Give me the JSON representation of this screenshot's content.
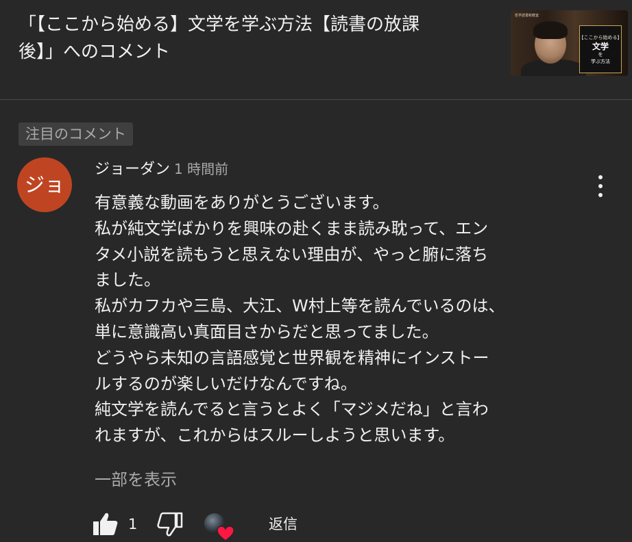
{
  "header": {
    "title_line1": "「【ここから始める】文学を学ぶ方法【読書の放課",
    "title_line2": "後】」へのコメント",
    "thumbnail": {
      "corner_text": "哲学読書新教室",
      "tag": "【ここから始める】",
      "big": "文学",
      "wo": "を",
      "small": "学ぶ方法"
    }
  },
  "pinned_label": "注目のコメント",
  "comment": {
    "avatar_text": "ジョ",
    "avatar_color": "#bf4522",
    "author": "ジョーダン",
    "time": "1 時間前",
    "lines": [
      "有意義な動画をありがとうございます。",
      "私が純文学ばかりを興味の赴くまま読み耽って、エン",
      "タメ小説を読もうと思えない理由が、やっと腑に落ち",
      "ました。",
      "私がカフカや三島、大江、W村上等を読んでいるのは、",
      "単に意識高い真面目さからだと思ってました。",
      "どうやら未知の言語感覚と世界観を精神にインストー",
      "ルするのが楽しいだけなんですね。",
      "純文学を読んでると言うとよく「マジメだね」と言わ",
      "れますが、これからはスルーしようと思います。"
    ],
    "show_more": "一部を表示",
    "like_count": "1",
    "reply_label": "返信"
  },
  "icons": {
    "like": "thumbs-up-icon",
    "dislike": "thumbs-down-icon",
    "more": "more-vertical-icon",
    "creator_heart": "heart-icon"
  },
  "colors": {
    "background": "#282828",
    "text": "#f1f1f1",
    "secondary_text": "#aaaaaa",
    "badge_bg": "#3f3f3f",
    "heart": "#ff1744"
  }
}
